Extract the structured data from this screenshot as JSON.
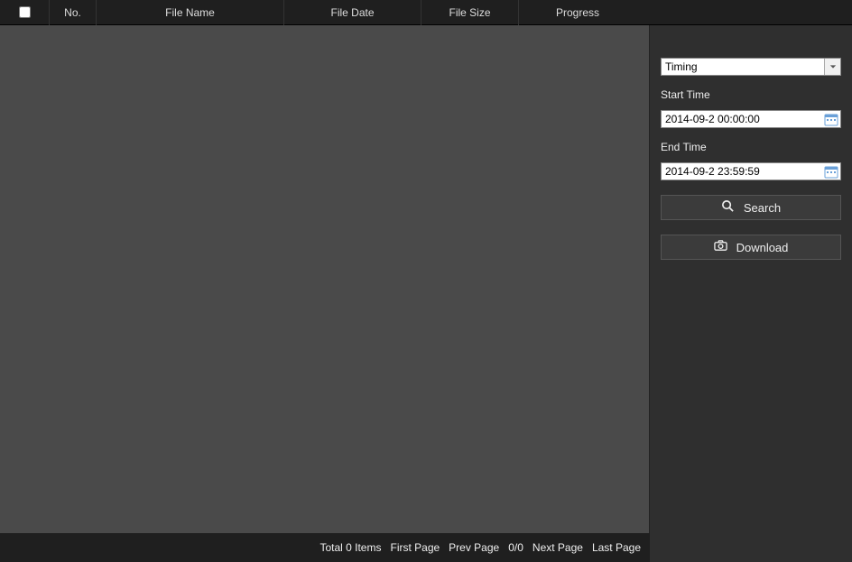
{
  "table": {
    "headers": {
      "no": "No.",
      "file_name": "File Name",
      "file_date": "File Date",
      "file_size": "File Size",
      "progress": "Progress"
    },
    "rows": []
  },
  "footer": {
    "total": "Total 0 Items",
    "first": "First Page",
    "prev": "Prev Page",
    "position": "0/0",
    "next": "Next Page",
    "last": "Last Page"
  },
  "side": {
    "select_value": "Timing",
    "start_label": "Start Time",
    "start_value": "2014-09-2 00:00:00",
    "end_label": "End Time",
    "end_value": "2014-09-2 23:59:59",
    "search_label": "Search",
    "download_label": "Download"
  }
}
